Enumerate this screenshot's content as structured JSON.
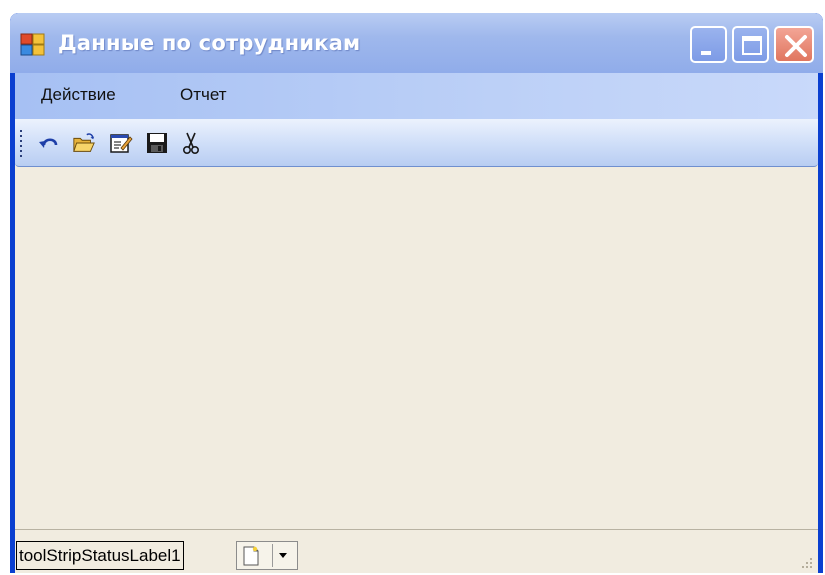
{
  "window": {
    "title": "Данные по сотрудникам"
  },
  "menu": {
    "items": [
      {
        "label": "Действие"
      },
      {
        "label": "Отчет"
      }
    ]
  },
  "toolbar": {
    "buttons": [
      {
        "icon": "undo-icon"
      },
      {
        "icon": "open-folder-icon"
      },
      {
        "icon": "edit-document-icon"
      },
      {
        "icon": "save-icon"
      },
      {
        "icon": "cut-scissors-icon"
      }
    ]
  },
  "statusbar": {
    "label": "toolStripStatusLabel1",
    "split_button_icon": "new-document-icon"
  },
  "colors": {
    "title_bar": "#9fb8ec",
    "window_border": "#0a3fd0",
    "client_background": "#f1ece0",
    "close_button": "#e0765f"
  }
}
